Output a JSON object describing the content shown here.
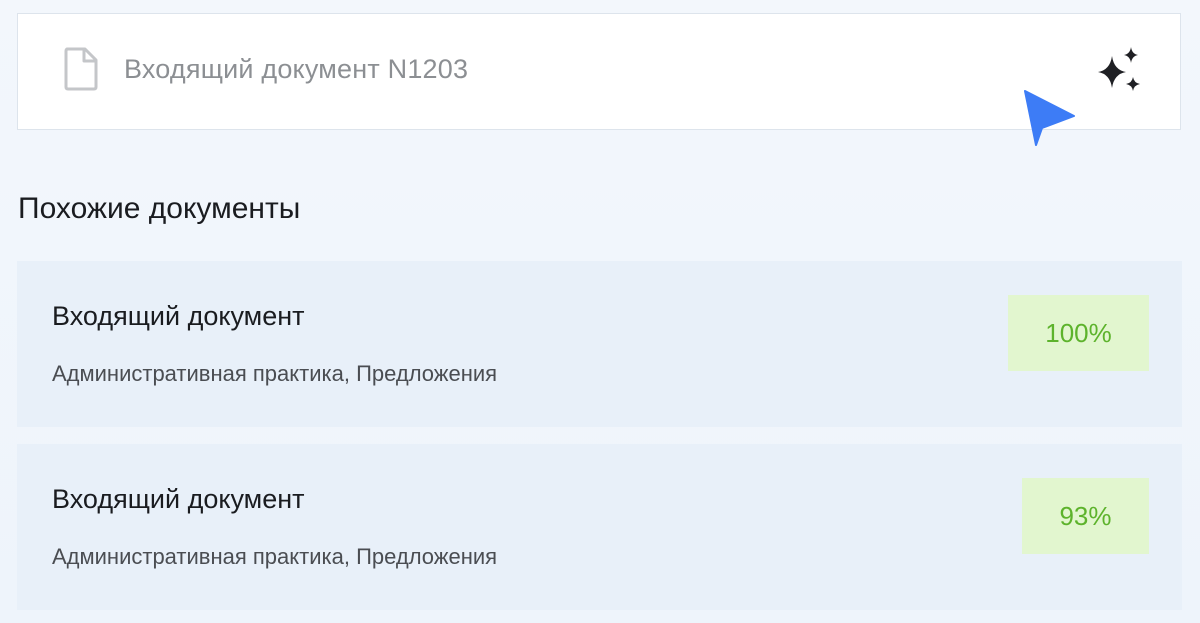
{
  "document": {
    "title": "Входящий документ N1203",
    "icon": "document-icon",
    "action_icon": "sparkles-icon"
  },
  "similar": {
    "heading": "Похожие документы",
    "items": [
      {
        "title": "Входящий документ",
        "tags": "Административная практика, Предложения",
        "match": "100%"
      },
      {
        "title": "Входящий документ",
        "tags": "Административная практика, Предложения",
        "match": "93%"
      }
    ]
  },
  "colors": {
    "accent_cursor": "#3d7cf6",
    "card_background": "#e8f0f9",
    "match_badge_background": "#e2f6cf",
    "match_badge_text": "#5db32c"
  }
}
